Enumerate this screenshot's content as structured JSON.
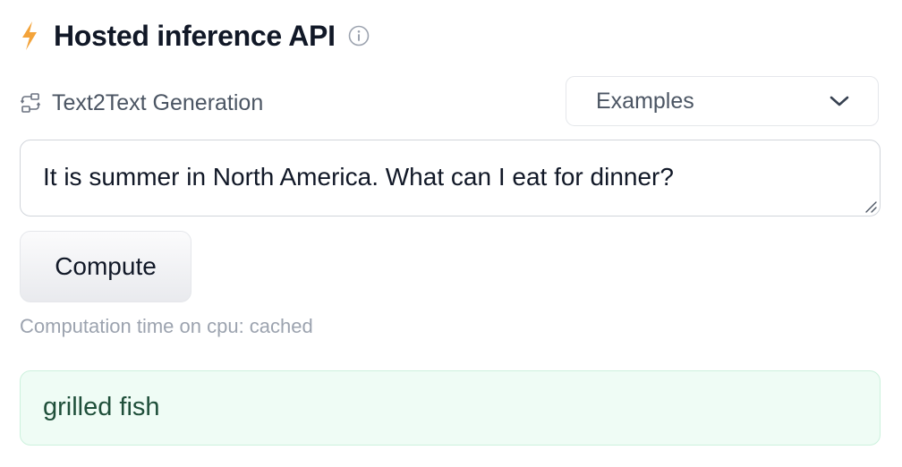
{
  "header": {
    "title": "Hosted inference API",
    "bolt_icon": "lightning-bolt-icon",
    "info_icon": "info-circle-icon",
    "accent_color": "#f3a33a"
  },
  "task": {
    "icon": "text2text-icon",
    "label": "Text2Text Generation"
  },
  "examples_dropdown": {
    "label": "Examples",
    "icon": "chevron-down-icon"
  },
  "input": {
    "value": "It is summer in North America. What can I eat for dinner?",
    "resize_icon": "resize-handle-icon"
  },
  "compute_button": {
    "label": "Compute"
  },
  "status": {
    "computation_time": "Computation time on cpu: cached"
  },
  "output": {
    "text": "grilled fish",
    "background_color": "#effcf5"
  }
}
